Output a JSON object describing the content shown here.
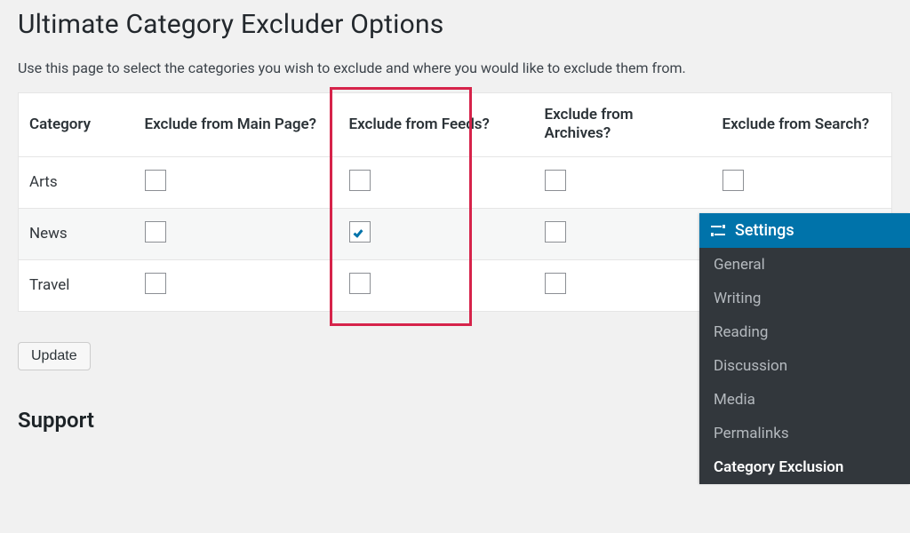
{
  "page": {
    "title": "Ultimate Category Excluder Options",
    "intro": "Use this page to select the categories you wish to exclude and where you would like to exclude them from.",
    "update_label": "Update",
    "support_heading": "Support"
  },
  "table": {
    "headers": {
      "category": "Category",
      "main": "Exclude from Main Page?",
      "feeds": "Exclude from Feeds?",
      "archives": "Exclude from Archives?",
      "search": "Exclude from Search?"
    },
    "rows": [
      {
        "name": "Arts",
        "main": false,
        "feeds": false,
        "archives": false,
        "search": false
      },
      {
        "name": "News",
        "main": false,
        "feeds": true,
        "archives": false,
        "search": false
      },
      {
        "name": "Travel",
        "main": false,
        "feeds": false,
        "archives": false,
        "search": false
      }
    ]
  },
  "highlight": {
    "column": "feeds"
  },
  "settings_panel": {
    "header": "Settings",
    "items": [
      {
        "label": "General",
        "active": false
      },
      {
        "label": "Writing",
        "active": false
      },
      {
        "label": "Reading",
        "active": false
      },
      {
        "label": "Discussion",
        "active": false
      },
      {
        "label": "Media",
        "active": false
      },
      {
        "label": "Permalinks",
        "active": false
      },
      {
        "label": "Category Exclusion",
        "active": true
      }
    ]
  }
}
